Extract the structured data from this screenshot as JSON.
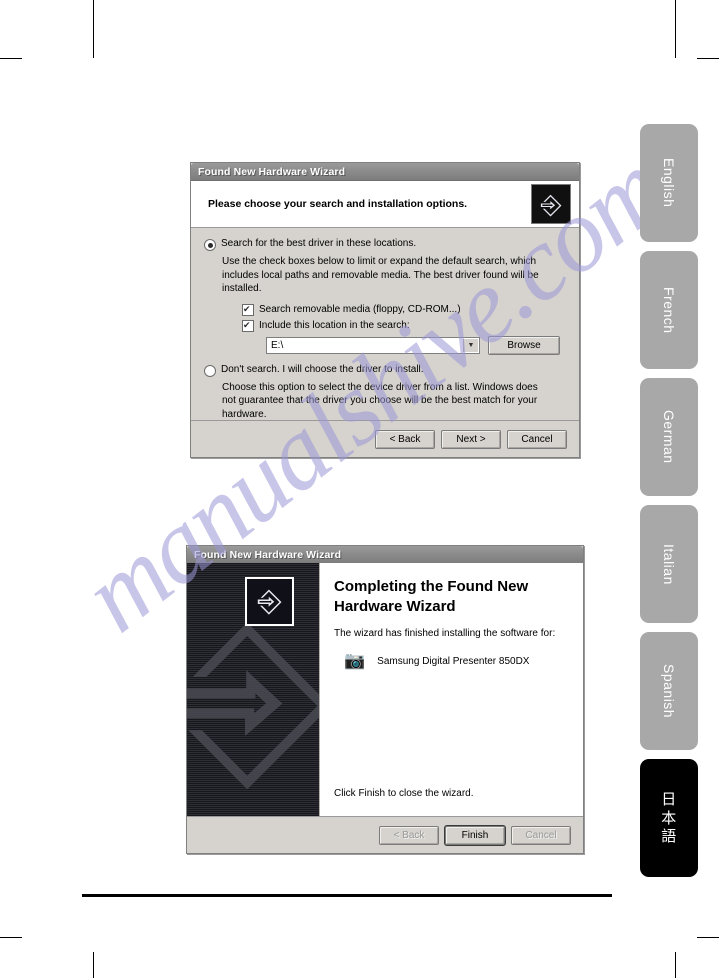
{
  "page": {
    "watermark_text": "manualshive.com"
  },
  "language_tabs": [
    {
      "label": "English",
      "active": false
    },
    {
      "label": "French",
      "active": false
    },
    {
      "label": "German",
      "active": false
    },
    {
      "label": "Italian",
      "active": false
    },
    {
      "label": "Spanish",
      "active": false
    },
    {
      "label": "日本語",
      "active": true
    }
  ],
  "dialog_search": {
    "title": "Found New Hardware Wizard",
    "header_title": "Please choose your search and installation options.",
    "icon_name": "wizard-hardware-icon",
    "option_search": {
      "label": "Search for the best driver in these locations.",
      "selected": true,
      "description": "Use the check boxes below to limit or expand the default search, which includes local paths and removable media. The best driver found will be installed.",
      "checkbox_removable": {
        "label": "Search removable media (floppy, CD-ROM...)",
        "checked": true
      },
      "checkbox_location": {
        "label": "Include this location in the search:",
        "checked": true
      },
      "path_value": "E:\\",
      "browse_label": "Browse"
    },
    "option_manual": {
      "label": "Don't search. I will choose the driver to install.",
      "selected": false,
      "description": "Choose this option to select the device driver from a list.  Windows does not guarantee that the driver you choose will be the best match for your hardware."
    },
    "buttons": {
      "back": "< Back",
      "next": "Next >",
      "cancel": "Cancel"
    }
  },
  "dialog_complete": {
    "title": "Found New Hardware Wizard",
    "heading_line1": "Completing the Found New",
    "heading_line2": "Hardware Wizard",
    "subtitle": "The wizard has finished installing the software for:",
    "device_name": "Samsung Digital Presenter 850DX",
    "device_icon_name": "camera-icon",
    "closing_text": "Click Finish to close the wizard.",
    "buttons": {
      "back": "< Back",
      "finish": "Finish",
      "cancel": "Cancel"
    }
  }
}
